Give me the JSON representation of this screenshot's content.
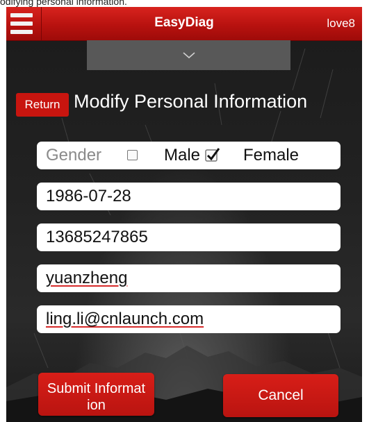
{
  "caption": "odifying personal information.",
  "header": {
    "title": "EasyDiag",
    "user": "love8"
  },
  "page": {
    "return_label": "Return",
    "title": "Modify Personal Information"
  },
  "form": {
    "gender": {
      "label": "Gender",
      "options": [
        {
          "label": "Male",
          "checked": false
        },
        {
          "label": "Female",
          "checked": true
        }
      ]
    },
    "birthday": "1986-07-28",
    "phone": "13685247865",
    "username": "yuanzheng",
    "email": "ling.li@cnlaunch.com"
  },
  "actions": {
    "submit_line1": "Submit Informat",
    "submit_line2": "ion",
    "cancel_label": "Cancel"
  },
  "colors": {
    "accent": "#c8150f",
    "background": "#222222"
  },
  "icons": [
    "menu-icon",
    "chevron-down-icon",
    "checkbox-icon",
    "checkmark-icon"
  ]
}
